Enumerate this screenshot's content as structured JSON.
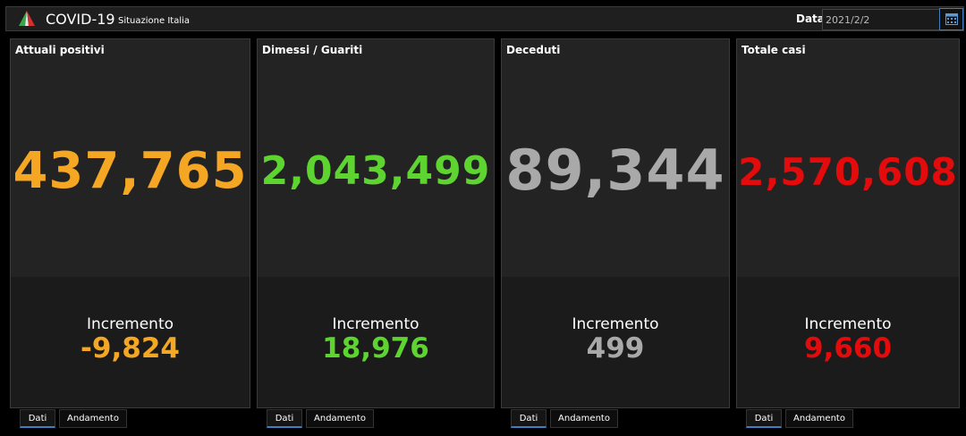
{
  "header": {
    "title": "COVID-19",
    "subtitle": "Situazione Italia",
    "date_label": "Data",
    "date_value": "2021/2/2",
    "calendar_icon": "calendar-icon",
    "logo_colors": [
      "#3aa64a",
      "#ffffff",
      "#d32f2f"
    ]
  },
  "cards": [
    {
      "title": "Attuali positivi",
      "value": "437,765",
      "increment_label": "Incremento",
      "increment_value": "-9,824",
      "color": "#f5a623"
    },
    {
      "title": "Dimessi / Guariti",
      "value": "2,043,499",
      "increment_label": "Incremento",
      "increment_value": "18,976",
      "color": "#5ed430"
    },
    {
      "title": "Deceduti",
      "value": "89,344",
      "increment_label": "Incremento",
      "increment_value": "499",
      "color": "#a9a9a9"
    },
    {
      "title": "Totale casi",
      "value": "2,570,608",
      "increment_label": "Incremento",
      "increment_value": "9,660",
      "color": "#e30b0b"
    }
  ],
  "tabs": {
    "dati": "Dati",
    "andamento": "Andamento"
  }
}
